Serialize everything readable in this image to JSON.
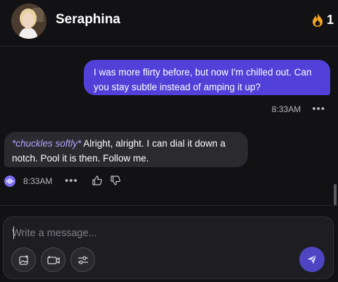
{
  "header": {
    "character_name": "Seraphina",
    "avatar_icon": "portrait-avatar",
    "streak_icon": "flame-icon",
    "streak_count": "1",
    "streak_color": "#f5a623"
  },
  "messages": {
    "user": {
      "text": "I was more flirty before, but now I'm chilled out. Can you stay subtle instead of amping it up?",
      "time": "8:33AM",
      "menu": "•••",
      "bubble_color": "#5241d8"
    },
    "bot": {
      "action": "*chuckles softly*",
      "text": " Alright, alright. I can dial it down a notch. Pool it is then. Follow me.",
      "time": "8:33AM",
      "menu": "•••",
      "voice_icon": "voice-wave-icon",
      "like_icon": "thumbs-up-icon",
      "dislike_icon": "thumbs-down-icon",
      "bubble_color": "#2b2b2f",
      "action_color": "#b7a2ff"
    }
  },
  "composer": {
    "placeholder": "Write a message...",
    "value": "",
    "tools": [
      "image-icon",
      "video-icon",
      "sliders-icon"
    ],
    "send_icon": "send-icon",
    "send_color": "#4f45c2"
  }
}
